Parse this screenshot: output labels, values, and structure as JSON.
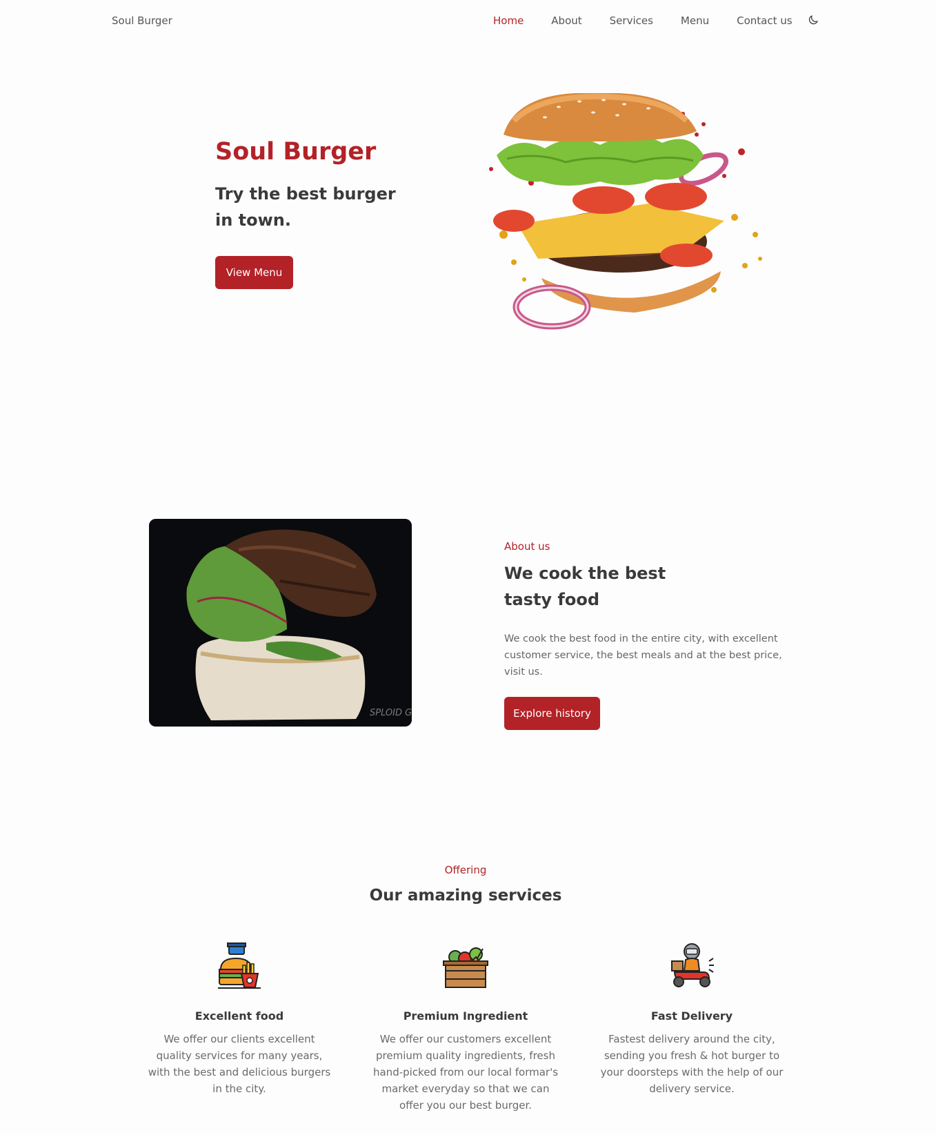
{
  "header": {
    "logo": "Soul Burger",
    "nav": [
      "Home",
      "About",
      "Services",
      "Menu",
      "Contact us"
    ],
    "active": "Home",
    "theme_icon": "moon-icon"
  },
  "hero": {
    "title": "Soul Burger",
    "subtitle": "Try the best burger in town.",
    "button": "View Menu",
    "image": "flying-burger-image"
  },
  "about": {
    "kicker": "About us",
    "title": "We cook the best tasty food",
    "text": "We cook the best food in the entire city, with excellent customer service, the best meals and at the best price, visit us.",
    "button": "Explore history",
    "watermark": "SPLOID GIF"
  },
  "services": {
    "kicker": "Offering",
    "title": "Our amazing services",
    "items": [
      {
        "icon": "burger-fries-icon",
        "title": "Excellent food",
        "text": "We offer our clients excellent quality services for many years, with the best and delicious burgers in the city."
      },
      {
        "icon": "vegetable-crate-icon",
        "title": "Premium Ingredient",
        "text": "We offer our customers excellent premium quality ingredients, fresh hand-picked from our local formar's market everyday so that we can offer you our best burger."
      },
      {
        "icon": "delivery-scooter-icon",
        "title": "Fast Delivery",
        "text": "Fastest delivery around the city, sending you fresh & hot burger to your doorsteps with the help of our delivery service."
      }
    ]
  },
  "colors": {
    "accent": "#b32227",
    "text": "#3a3a3a",
    "muted": "#666666",
    "background": "#fdfdfd"
  }
}
